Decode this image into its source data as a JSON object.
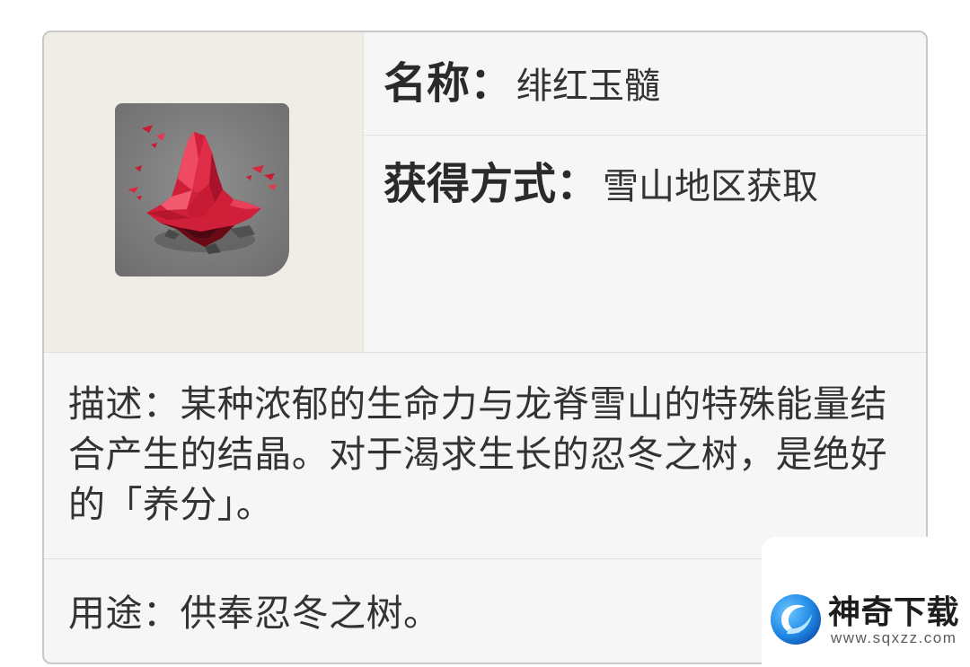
{
  "item": {
    "icon": "red-crystal-icon"
  },
  "name": {
    "label": "名称：",
    "value": "绯红玉髓"
  },
  "acquisition": {
    "label": "获得方式：",
    "value": "雪山地区获取"
  },
  "description": {
    "label": "描述：",
    "text": "某种浓郁的生命力与龙脊雪山的特殊能量结合产生的结晶。对于渴求生长的忍冬之树，是绝好的「养分」。"
  },
  "usage": {
    "label": "用途：",
    "text": "供奉忍冬之树。"
  },
  "watermark": {
    "icon": "sqxzz-logo-icon",
    "brand": "神奇下载",
    "url": "www.sqxzz.com"
  },
  "colors": {
    "text": "#333333",
    "label_text": "#2a2a2a",
    "border": "#c9c9c9",
    "divider": "#e0e0e0",
    "cell_bg": "#f6f6f6",
    "image_cell_bg": "#f0ede6",
    "crystal_red": "#cf1f39",
    "logo_blue": "#1e88e5"
  }
}
